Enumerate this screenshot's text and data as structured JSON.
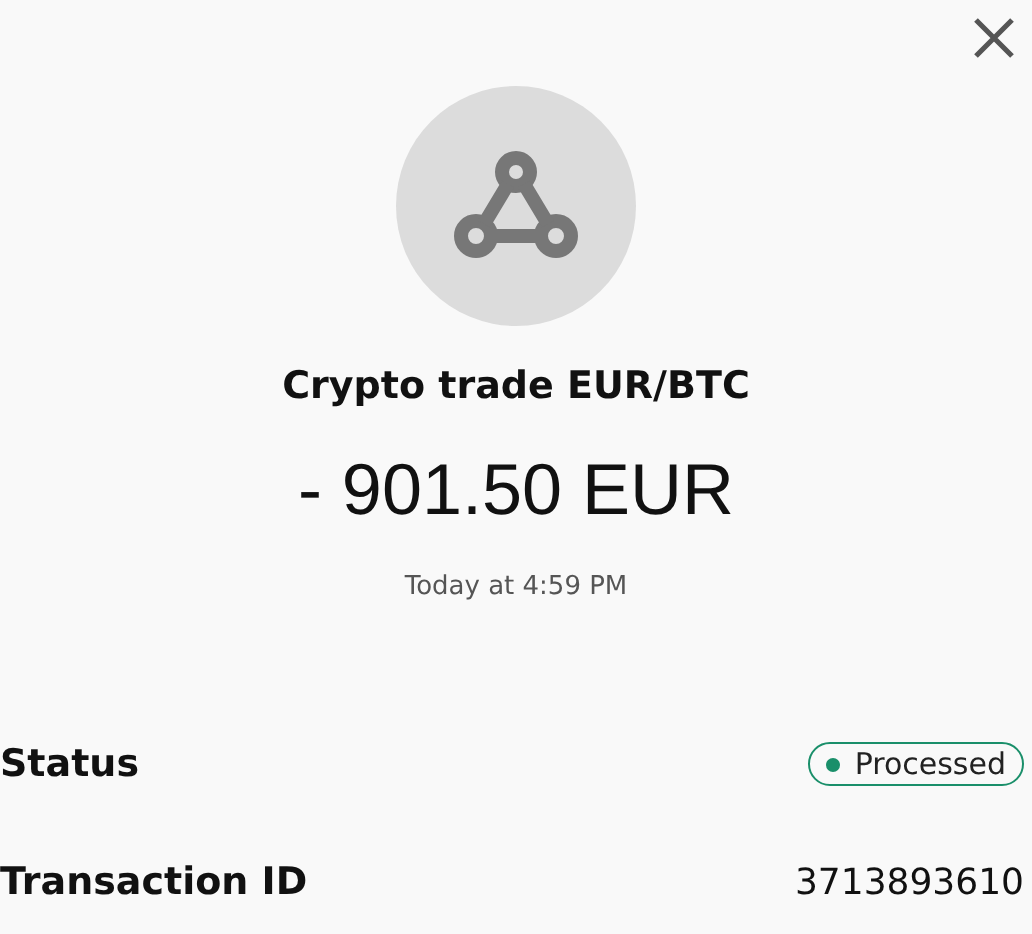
{
  "title": "Crypto trade EUR/BTC",
  "amount": "- 901.50 EUR",
  "time": "Today at 4:59 PM",
  "details": [
    {
      "kind": "badge",
      "label": "Status",
      "value": "Processed"
    },
    {
      "kind": "text",
      "label": "Transaction ID",
      "value": "3713893610"
    }
  ]
}
